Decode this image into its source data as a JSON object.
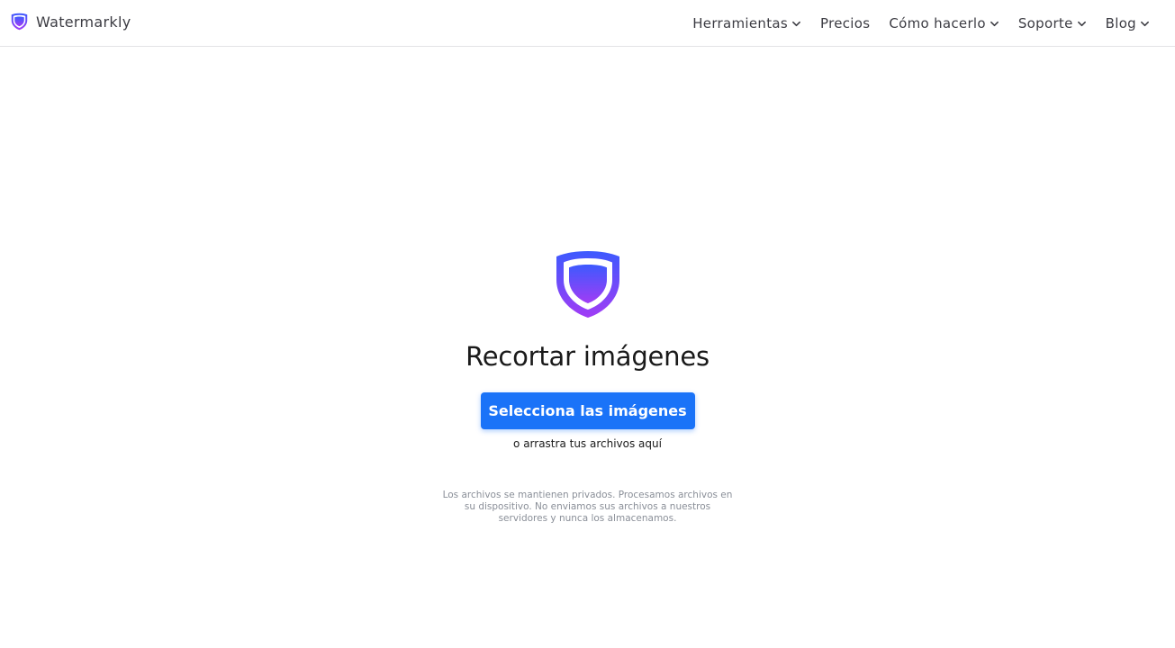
{
  "header": {
    "brand_name": "Watermarkly",
    "nav": [
      {
        "label": "Herramientas",
        "has_dropdown": true
      },
      {
        "label": "Precios",
        "has_dropdown": false
      },
      {
        "label": "Cómo hacerlo",
        "has_dropdown": true
      },
      {
        "label": "Soporte",
        "has_dropdown": true
      },
      {
        "label": "Blog",
        "has_dropdown": true
      }
    ]
  },
  "main": {
    "title": "Recortar imágenes",
    "select_button_label": "Selecciona las imágenes",
    "drop_hint": "o arrastra tus archivos aquí",
    "privacy_note": "Los archivos se mantienen privados. Procesamos archivos en su dispositivo. No enviamos sus archivos a nuestros servidores y nunca los almacenamos."
  },
  "colors": {
    "accent": "#1a73f8",
    "logo_gradient_start": "#3d5afe",
    "logo_gradient_end": "#a13cf5",
    "text_muted": "#8a8f98"
  },
  "icons": {
    "brand_logo": "shield-logo-icon",
    "dropdown": "chevron-down-icon"
  }
}
